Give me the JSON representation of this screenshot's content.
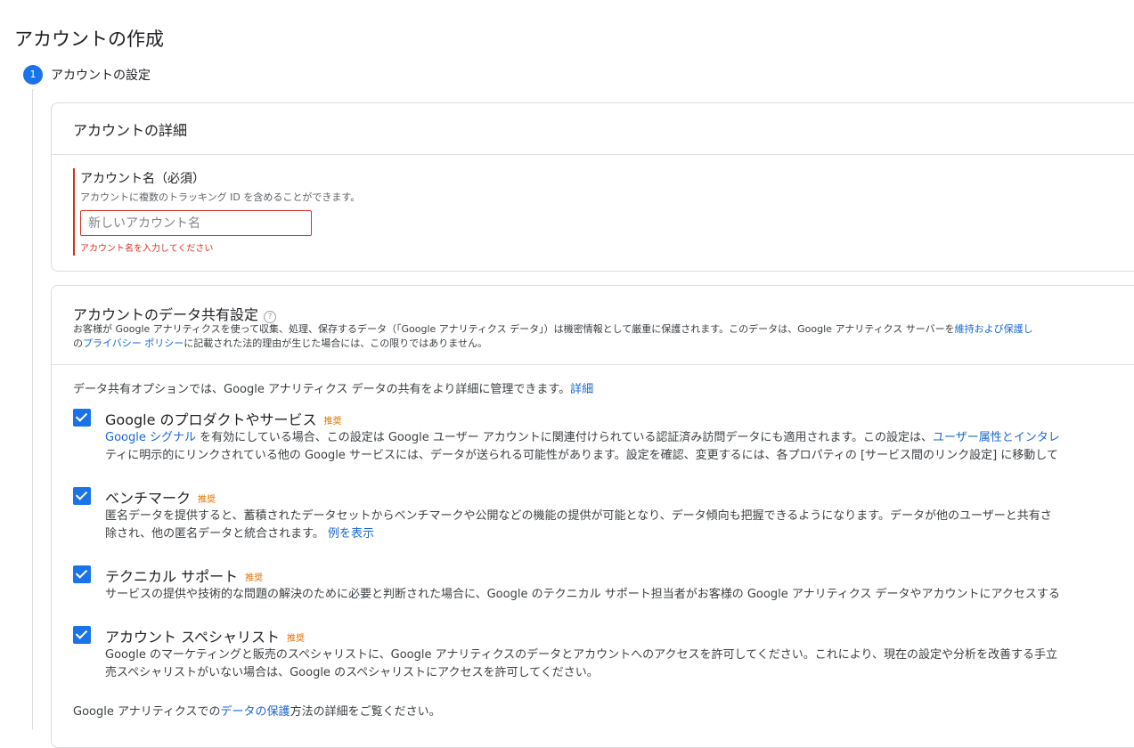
{
  "page": {
    "title": "アカウントの作成"
  },
  "step": {
    "number": "1",
    "label": "アカウントの設定"
  },
  "details": {
    "title": "アカウントの詳細",
    "name_label": "アカウント名（必須）",
    "name_hint": "アカウントに複数のトラッキング ID を含めることができます。",
    "name_value": "",
    "name_placeholder": "新しいアカウント名",
    "name_error": "アカウント名を入力してください"
  },
  "sharing": {
    "title": "アカウントのデータ共有設定",
    "help_icon": "?",
    "desc_line1_a": "お客様が Google アナリティクスを使って収集、処理、保存するデータ（「Google アナリティクス データ」）は機密情報として厳重に保護されます。このデータは、Google アナリティクス サーバーを",
    "desc_line1_link": "維持および保護し",
    "desc_line2_a": "の",
    "desc_line2_link": "プライバシー ポリシー",
    "desc_line2_b": "に記載された法的理由が生じた場合には、この限りではありません。",
    "intro_text": "データ共有オプションでは、Google アナリティクス データの共有をより詳細に管理できます。",
    "intro_link": "詳細",
    "recommended_badge": "推奨",
    "options": [
      {
        "title": "Google のプロダクトやサービス",
        "checked": true,
        "line1_link": "Google シグナル",
        "line1_text": " を有効にしている場合、この設定は Google ユーザー アカウントに関連付けられている認証済み訪問データにも適用されます。この設定は、",
        "line1_link2": "ユーザー属性とインタレ",
        "line2_text": "ティに明示的にリンクされている他の Google サービスには、データが送られる可能性があります。設定を確認、変更するには、各プロパティの [サービス間のリンク設定] に移動して"
      },
      {
        "title": "ベンチマーク",
        "checked": true,
        "line1_text": "匿名データを提供すると、蓄積されたデータセットからベンチマークや公開などの機能の提供が可能となり、データ傾向も把握できるようになります。データが他のユーザーと共有さ",
        "line2_text": "除され、他の匿名データと統合されます。 ",
        "line2_link": "例を表示"
      },
      {
        "title": "テクニカル サポート",
        "checked": true,
        "line1_text": "サービスの提供や技術的な問題の解決のために必要と判断された場合に、Google のテクニカル サポート担当者がお客様の Google アナリティクス データやアカウントにアクセスする"
      },
      {
        "title": "アカウント スペシャリスト",
        "checked": true,
        "line1_text": "Google のマーケティングと販売のスペシャリストに、Google アナリティクスのデータとアカウントへのアクセスを許可してください。これにより、現在の設定や分析を改善する手立",
        "line2_text": "売スペシャリストがいない場合は、Google のスペシャリストにアクセスを許可してください。"
      }
    ],
    "footer_a": "Google アナリティクスでの",
    "footer_link": "データの保護",
    "footer_b": "方法の詳細をご覧ください。"
  }
}
